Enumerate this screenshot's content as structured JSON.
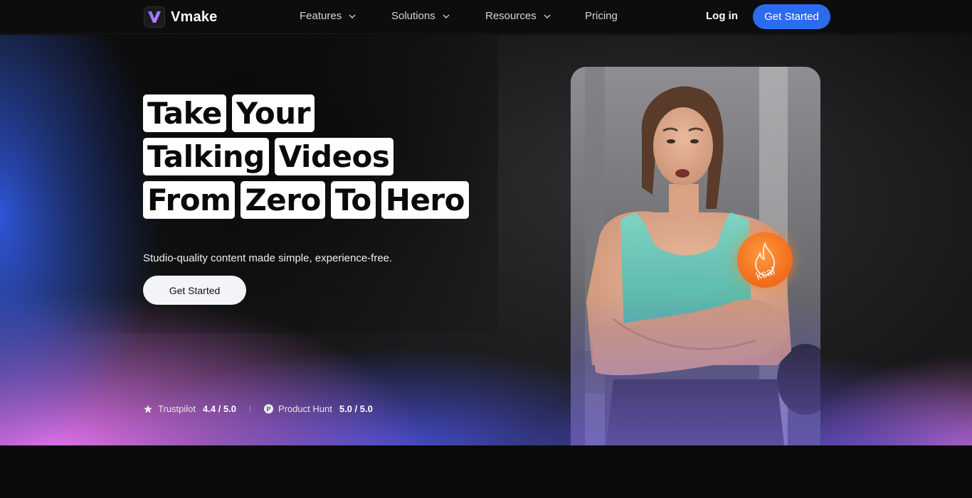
{
  "brand": {
    "name": "Vmake",
    "logo_icon": "v-logo-icon"
  },
  "nav": {
    "items": [
      {
        "label": "Features",
        "has_dropdown": true
      },
      {
        "label": "Solutions",
        "has_dropdown": true
      },
      {
        "label": "Resources",
        "has_dropdown": true
      },
      {
        "label": "Pricing",
        "has_dropdown": false
      }
    ],
    "login": "Log in",
    "cta": "Get Started"
  },
  "hero": {
    "headline_rows": [
      [
        "Take",
        "Your"
      ],
      [
        "Talking",
        "Videos"
      ],
      [
        "From",
        "Zero",
        "To",
        "Hero"
      ]
    ],
    "subtitle": "Studio-quality content made simple, experience-free.",
    "cta": "Get Started",
    "ratings": [
      {
        "icon": "star-icon",
        "source": "Trustpilot",
        "score": "4.4 / 5.0"
      },
      {
        "icon": "product-hunt-icon",
        "source": "Product Hunt",
        "score": "5.0 / 5.0"
      }
    ],
    "video_sticker": {
      "icon": "flame-icon",
      "text": "kcal"
    }
  },
  "colors": {
    "accent": "#2b6bf0",
    "nav_bg": "#0d0d0d",
    "hero_blue": "#3464ff",
    "hero_pink": "#ee78ff",
    "sticker_orange": "#f27a22"
  }
}
